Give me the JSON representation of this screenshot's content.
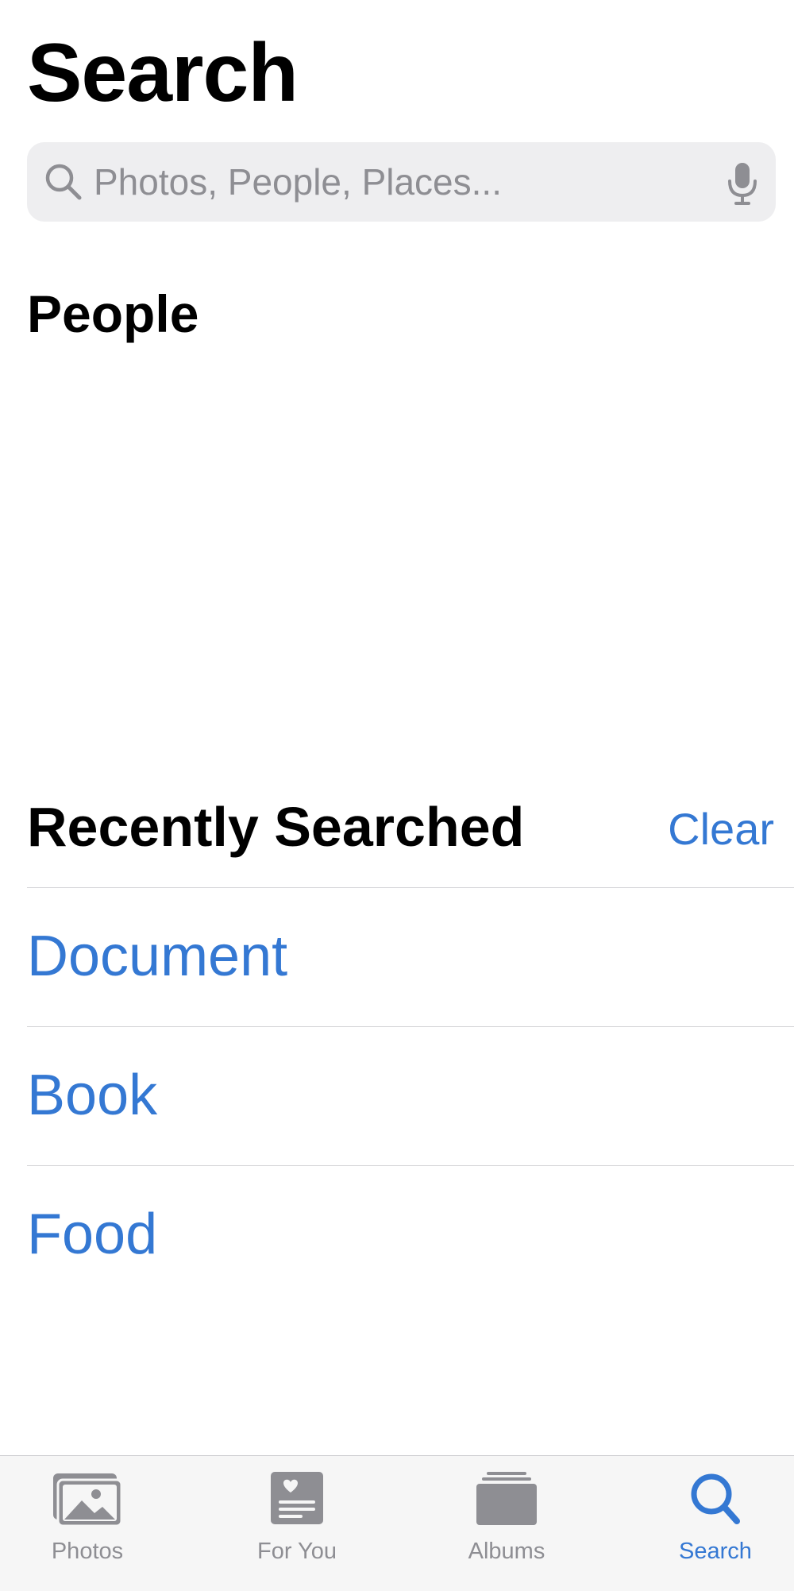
{
  "header": {
    "title": "Search"
  },
  "search": {
    "placeholder": "Photos, People, Places...",
    "value": "",
    "icon": "search-icon",
    "voice_icon": "microphone-icon"
  },
  "sections": {
    "people": {
      "title": "People"
    },
    "recent": {
      "title": "Recently Searched",
      "clear_label": "Clear",
      "items": [
        {
          "label": "Document"
        },
        {
          "label": "Book"
        },
        {
          "label": "Food"
        }
      ]
    }
  },
  "tab_bar": {
    "active": "Search",
    "tabs": [
      {
        "label": "Photos",
        "icon": "photos-icon"
      },
      {
        "label": "For You",
        "icon": "for-you-icon"
      },
      {
        "label": "Albums",
        "icon": "albums-icon"
      },
      {
        "label": "Search",
        "icon": "search-icon"
      }
    ]
  },
  "colors": {
    "accent": "#3478d3",
    "inactive": "#8e8e93",
    "search_field_bg": "#eeeef0",
    "separator": "#d5d5d8",
    "tab_bar_bg": "#f6f6f6"
  }
}
